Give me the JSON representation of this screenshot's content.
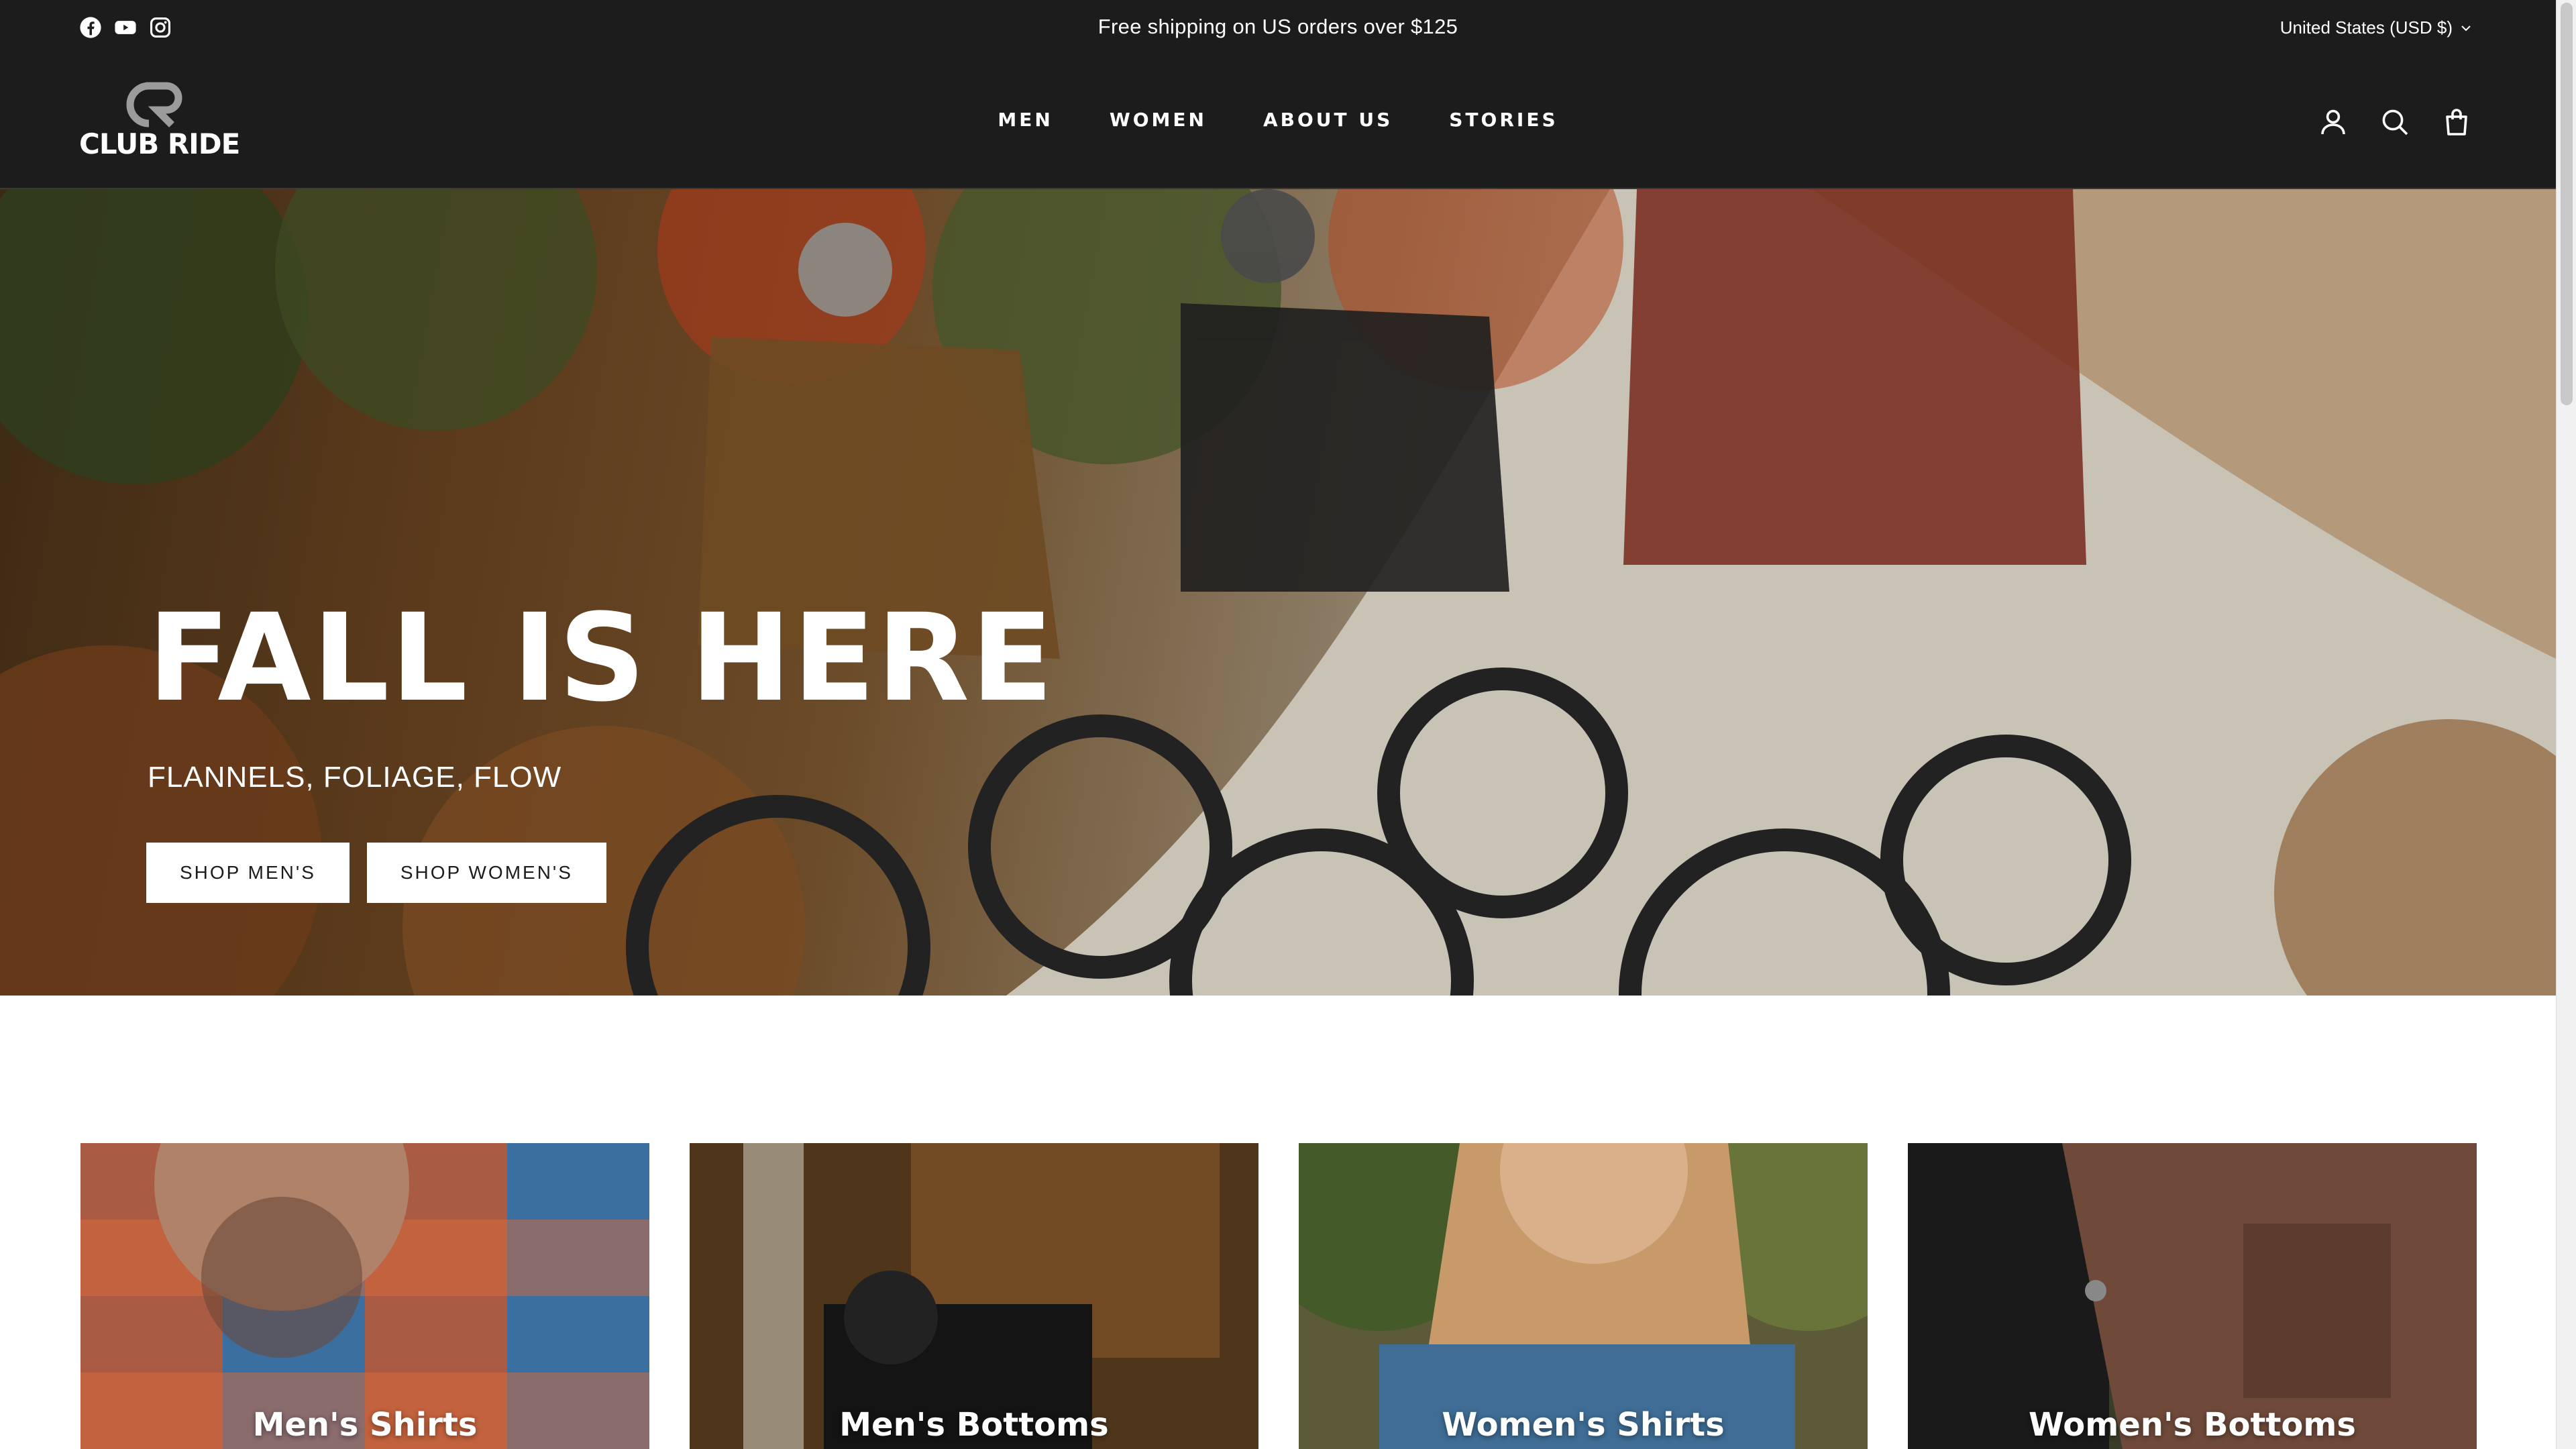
{
  "announcement": {
    "text": "Free shipping on US orders over $125",
    "social_icons": [
      "facebook-icon",
      "youtube-icon",
      "instagram-icon"
    ],
    "currency": "United States (USD $)"
  },
  "header": {
    "logo_text": "CLUB RIDE",
    "nav": [
      "MEN",
      "WOMEN",
      "ABOUT US",
      "STORIES"
    ],
    "icons": [
      "account-icon",
      "search-icon",
      "cart-icon"
    ]
  },
  "hero": {
    "title": "FALL IS HERE",
    "subtitle": "FLANNELS, FOLIAGE, FLOW",
    "buttons": [
      "SHOP MEN'S",
      "SHOP WOMEN'S"
    ]
  },
  "collections": [
    {
      "label": "Men's Shirts"
    },
    {
      "label": "Men's Bottoms"
    },
    {
      "label": "Women's Shirts"
    },
    {
      "label": "Women's Bottoms"
    }
  ],
  "colors": {
    "header_bg": "#1c1c1c",
    "text_light": "#ffffff",
    "button_bg": "#ffffff"
  }
}
